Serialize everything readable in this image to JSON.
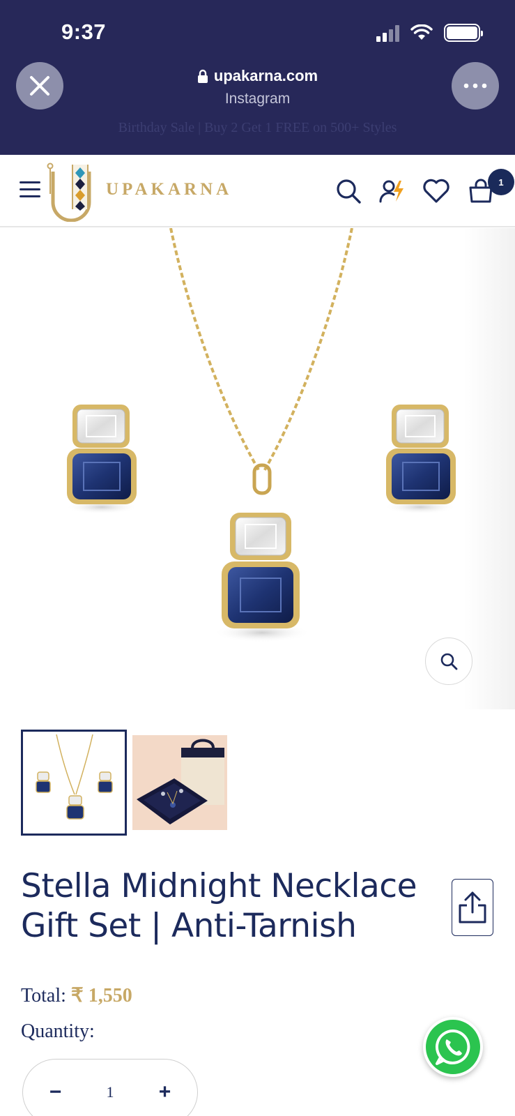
{
  "status_bar": {
    "time": "9:37"
  },
  "browser": {
    "domain": "upakarna.com",
    "source": "Instagram",
    "close_icon": "close-icon",
    "more_icon": "more-dots-icon"
  },
  "promo_text": "Birthday Sale | Buy 2 Get 1 FREE on 500+ Styles",
  "header": {
    "brand": "UPAKARNA",
    "cart_count": "1",
    "icons": [
      "menu-icon",
      "search-icon",
      "account-icon",
      "wishlist-icon",
      "cart-icon"
    ]
  },
  "product": {
    "title_line1": "Stella Midnight Necklace",
    "title_line2": "Gift Set | Anti-Tarnish",
    "total_label": "Total:",
    "price": "₹ 1,550",
    "quantity_label": "Quantity:",
    "quantity": "1",
    "minus_label": "−",
    "plus_label": "+"
  },
  "colors": {
    "chrome": "#272859",
    "brand_navy": "#1c2a5c",
    "gold": "#c7a866",
    "sapphire": "#1e3372",
    "whatsapp": "#2bc44f"
  }
}
